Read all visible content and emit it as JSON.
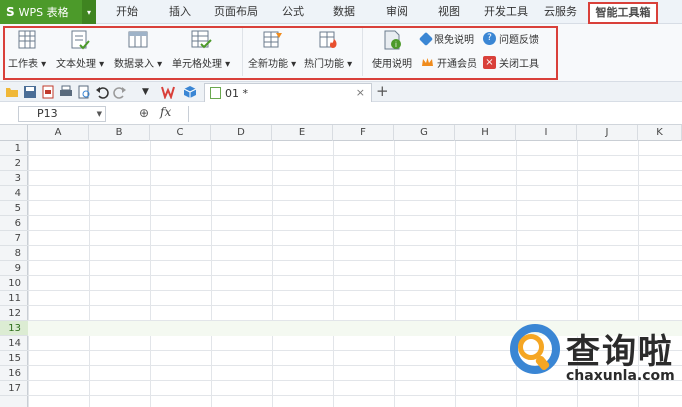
{
  "app": {
    "logo": "S",
    "name": "WPS 表格",
    "dropdown": "▾"
  },
  "menu": {
    "items": [
      "开始",
      "插入",
      "页面布局",
      "公式",
      "数据",
      "审阅",
      "视图",
      "开发工具",
      "云服务"
    ],
    "active": "智能工具箱"
  },
  "ribbon": {
    "buttons": [
      {
        "label": "工作表 ▾",
        "icon": "worksheet-icon"
      },
      {
        "label": "文本处理 ▾",
        "icon": "text-process-icon"
      },
      {
        "label": "数据录入 ▾",
        "icon": "data-entry-icon"
      },
      {
        "label": "单元格处理 ▾",
        "icon": "cell-process-icon"
      },
      {
        "label": "全新功能 ▾",
        "icon": "new-feature-icon"
      },
      {
        "label": "热门功能 ▾",
        "icon": "hot-feature-icon"
      },
      {
        "label": "使用说明",
        "icon": "usage-guide-icon"
      }
    ],
    "small": [
      {
        "label": "限免说明",
        "icon": "tag-icon",
        "color": "#3a86d4"
      },
      {
        "label": "问题反馈",
        "icon": "help-icon",
        "color": "#3a86d4"
      },
      {
        "label": "开通会员",
        "icon": "crown-icon",
        "color": "#f08c1e"
      },
      {
        "label": "关闭工具",
        "icon": "close-tool-icon",
        "color": "#d9403a"
      }
    ]
  },
  "document": {
    "tab_name": "01 *",
    "close": "×",
    "add": "+"
  },
  "formula_bar": {
    "cell_ref": "P13",
    "zoom_symbol": "⊕",
    "fx": "fx",
    "value": ""
  },
  "grid": {
    "columns": [
      "A",
      "B",
      "C",
      "D",
      "E",
      "F",
      "G",
      "H",
      "I",
      "J",
      "K"
    ],
    "rows": [
      "1",
      "2",
      "3",
      "4",
      "5",
      "6",
      "7",
      "8",
      "9",
      "10",
      "11",
      "12",
      "13",
      "14",
      "15",
      "16",
      "17"
    ],
    "active_row": "13"
  },
  "watermark": {
    "brand": "查询啦",
    "url": "chaxunla.com"
  },
  "colors": {
    "accent": "#4c9a2a",
    "highlight": "#d9403a",
    "brand_blue": "#3a86d4",
    "brand_orange": "#f5a623"
  }
}
